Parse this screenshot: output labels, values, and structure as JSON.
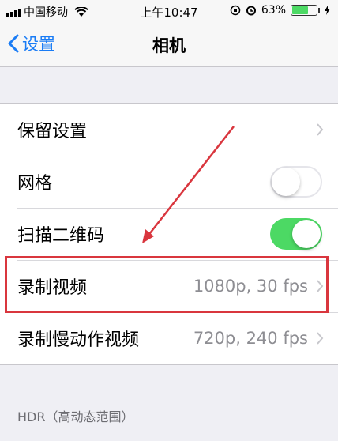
{
  "status_bar": {
    "carrier": "中国移动",
    "time": "上午10:47",
    "battery_percent": "63%",
    "battery_level": 0.63
  },
  "nav": {
    "back_label": "设置",
    "title": "相机"
  },
  "settings": {
    "rows": [
      {
        "label": "保留设置",
        "kind": "disclosure"
      },
      {
        "label": "网格",
        "kind": "toggle",
        "state": "off"
      },
      {
        "label": "扫描二维码",
        "kind": "toggle",
        "state": "on"
      },
      {
        "label": "录制视频",
        "value": "1080p, 30 fps",
        "kind": "disclosure"
      },
      {
        "label": "录制慢动作视频",
        "value": "720p, 240 fps",
        "kind": "disclosure"
      }
    ],
    "section_footer": "HDR（高动态范围）"
  },
  "colors": {
    "accent": "#1a7cf5",
    "toggle_on": "#4cd964",
    "annotation_red": "#d9363e"
  }
}
